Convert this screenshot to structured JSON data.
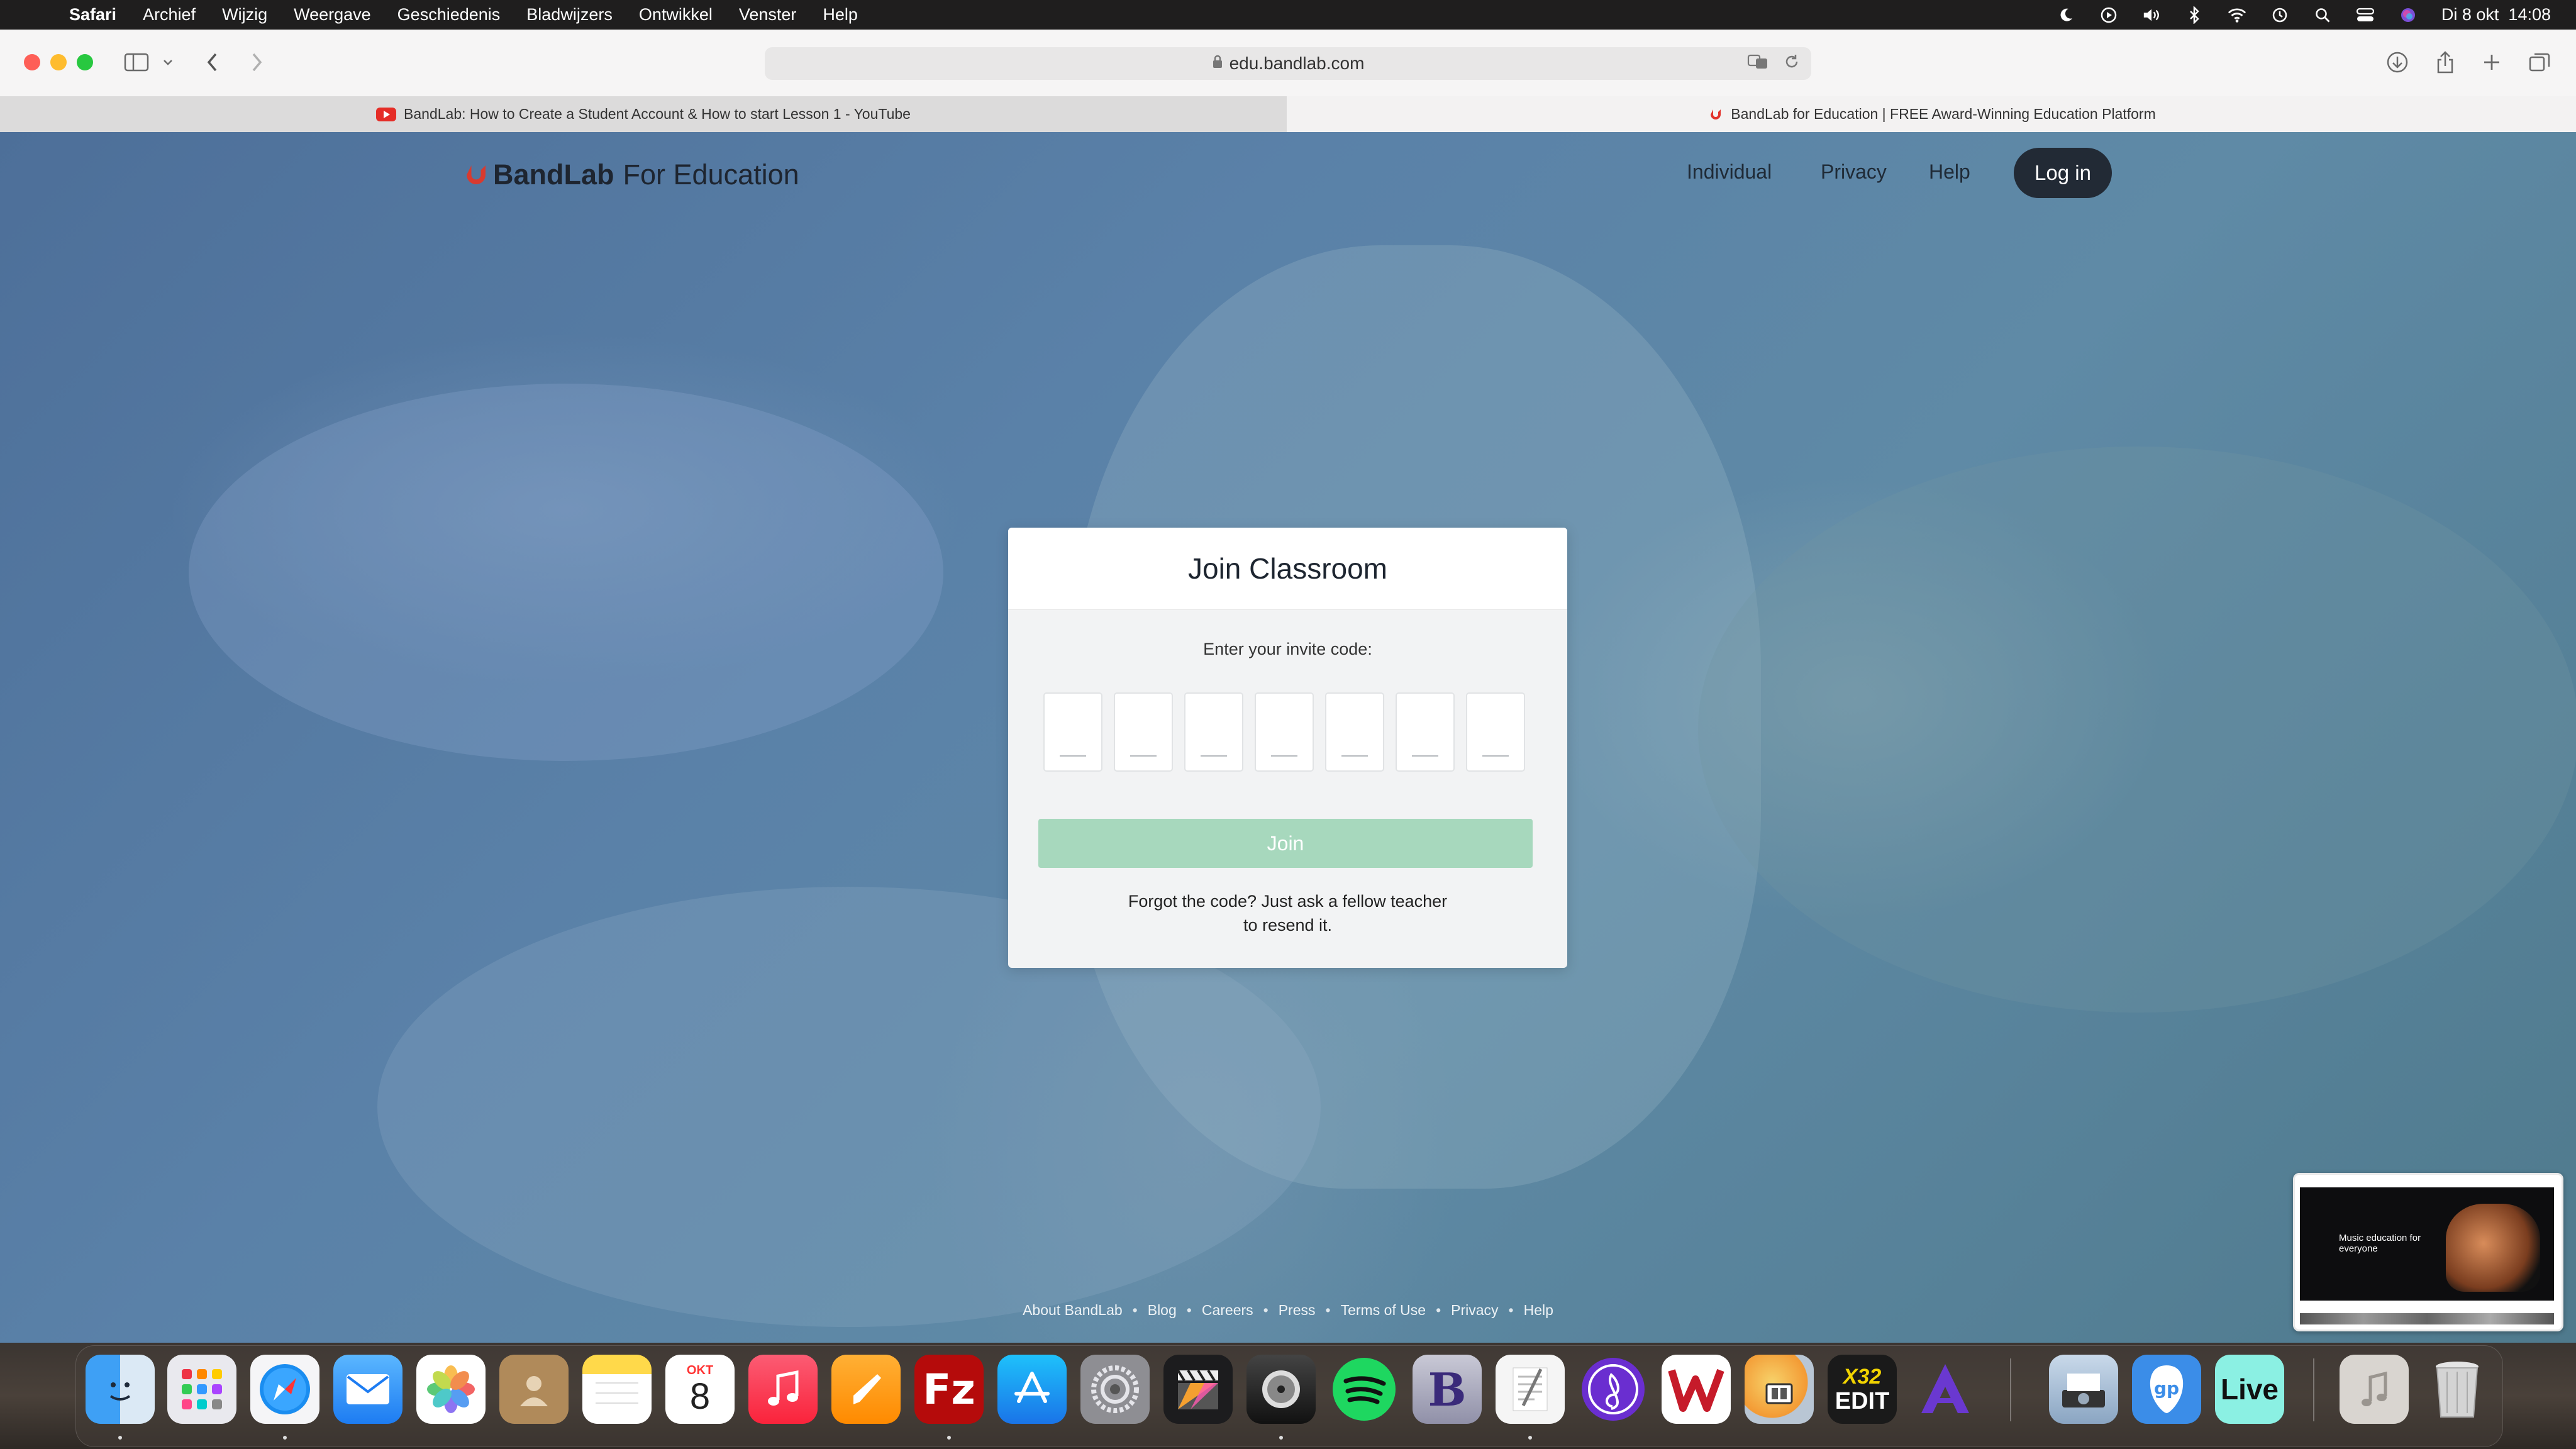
{
  "menubar": {
    "apple_glyph": "",
    "items": [
      "Safari",
      "Archief",
      "Wijzig",
      "Weergave",
      "Geschiedenis",
      "Bladwijzers",
      "Ontwikkel",
      "Venster",
      "Help"
    ],
    "datetime": "Di 8 okt  14:08"
  },
  "toolbar": {
    "url": "edu.bandlab.com"
  },
  "tabs": [
    {
      "title": "BandLab: How to Create a Student Account & How to start Lesson 1 - YouTube"
    },
    {
      "title": "BandLab for Education | FREE Award-Winning Education Platform"
    }
  ],
  "nav": {
    "logo_bold": "BandLab",
    "logo_rest": "For Education",
    "links": [
      "Individual",
      "Privacy",
      "Help"
    ],
    "login": "Log in"
  },
  "card": {
    "title": "Join Classroom",
    "invite_label": "Enter your invite code:",
    "join_button": "Join",
    "forgot_line1": "Forgot the code? Just ask a fellow teacher",
    "forgot_line2": "to resend it."
  },
  "footer": {
    "links": [
      "About BandLab",
      "Blog",
      "Careers",
      "Press",
      "Terms of Use",
      "Privacy",
      "Help"
    ],
    "separator": "•"
  },
  "thumbnail": {
    "headline": "Music education for everyone"
  },
  "dock": {
    "calendar_month": "OKT",
    "calendar_day": "8",
    "xedit_top": "X32",
    "xedit_label": "EDIT",
    "live_label": "Live",
    "gp_label": "gp",
    "b_label": "B"
  }
}
